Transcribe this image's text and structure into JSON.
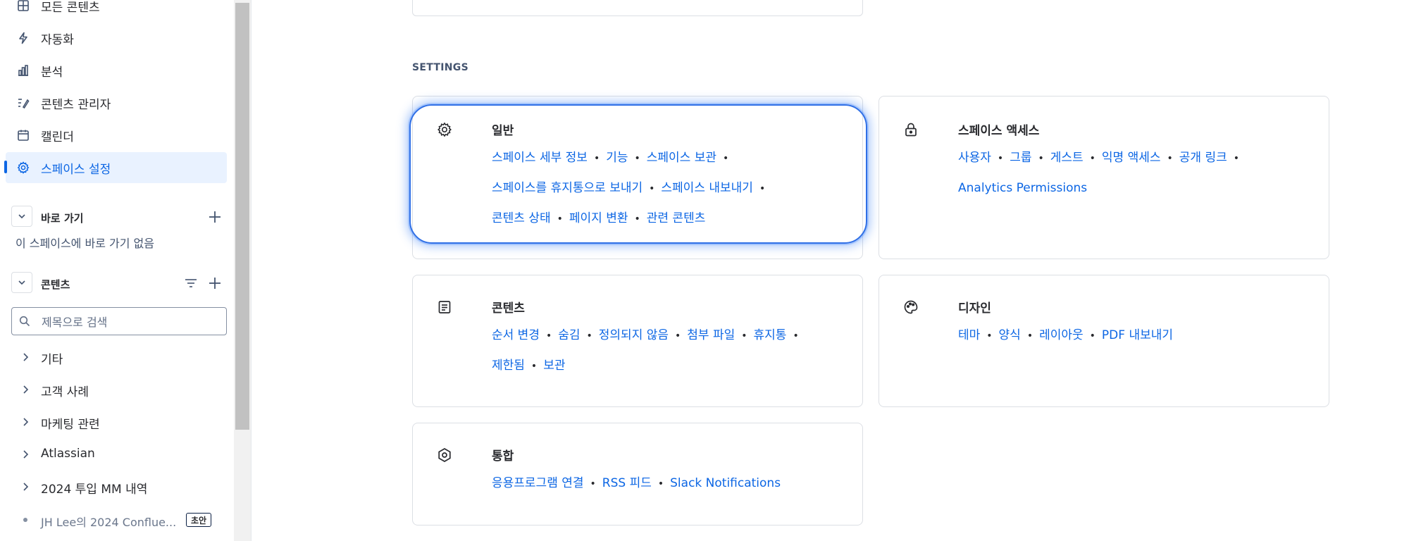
{
  "sidebar": {
    "nav": [
      {
        "label": "모든 콘텐츠",
        "icon": "grid-icon"
      },
      {
        "label": "자동화",
        "icon": "lightning-icon"
      },
      {
        "label": "분석",
        "icon": "bar-chart-icon"
      },
      {
        "label": "콘텐츠 관리자",
        "icon": "content-manager-icon"
      },
      {
        "label": "캘린더",
        "icon": "calendar-icon"
      },
      {
        "label": "스페이스 설정",
        "icon": "gear-icon",
        "active": true
      }
    ],
    "shortcuts": {
      "title": "바로 가기",
      "empty_text": "이 스페이스에 바로 가기 없음"
    },
    "content": {
      "title": "콘텐츠",
      "search_placeholder": "제목으로 검색",
      "tree": [
        {
          "label": "기타"
        },
        {
          "label": "고객 사례"
        },
        {
          "label": "마케팅 관련"
        },
        {
          "label": "Atlassian"
        },
        {
          "label": "2024 투입 MM 내역"
        },
        {
          "label": "JH Lee의 2024 Conflue...",
          "badge": "초안"
        }
      ]
    }
  },
  "main": {
    "section_label": "SETTINGS",
    "cards": {
      "general": {
        "title": "일반",
        "icon": "gear-icon",
        "links": [
          "스페이스 세부 정보",
          "기능",
          "스페이스 보관",
          "스페이스를 휴지통으로 보내기",
          "스페이스 내보내기",
          "콘텐츠 상태",
          "페이지 변환",
          "관련 콘텐츠"
        ]
      },
      "access": {
        "title": "스페이스 액세스",
        "icon": "lock-icon",
        "links": [
          "사용자",
          "그룹",
          "게스트",
          "익명 액세스",
          "공개 링크",
          "Analytics Permissions"
        ]
      },
      "content": {
        "title": "콘텐츠",
        "icon": "document-icon",
        "links": [
          "순서 변경",
          "숨김",
          "정의되지 않음",
          "첨부 파일",
          "휴지통",
          "제한됨",
          "보관"
        ]
      },
      "design": {
        "title": "디자인",
        "icon": "palette-icon",
        "links": [
          "테마",
          "양식",
          "레이아웃",
          "PDF 내보내기"
        ]
      },
      "integration": {
        "title": "통합",
        "icon": "hexagon-icon",
        "links": [
          "응용프로그램 연결",
          "RSS 피드",
          "Slack Notifications"
        ]
      }
    }
  }
}
